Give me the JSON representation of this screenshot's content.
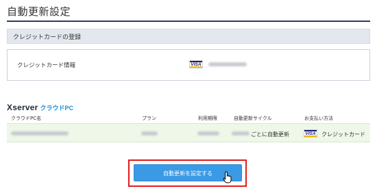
{
  "page": {
    "title": "自動更新設定"
  },
  "section": {
    "title": "クレジットカードの登録"
  },
  "card": {
    "label": "クレジットカード情報",
    "brand": "VISA"
  },
  "service": {
    "brand": "Xserver",
    "product": "クラウドPC"
  },
  "table": {
    "headers": [
      "クラウドPC名",
      "プラン",
      "利用期限",
      "自動更新サイクル",
      "お支払い方法"
    ],
    "row": {
      "cycle_suffix": "ごとに自動更新",
      "payment_brand": "VISA",
      "payment_label": "クレジットカード"
    }
  },
  "cta": {
    "label": "自動更新を設定する"
  },
  "colors": {
    "accent": "#3a9ae5",
    "highlight": "#e21b1b",
    "row_bg": "#eef7e8",
    "brand_blue": "#1b8fd6"
  }
}
